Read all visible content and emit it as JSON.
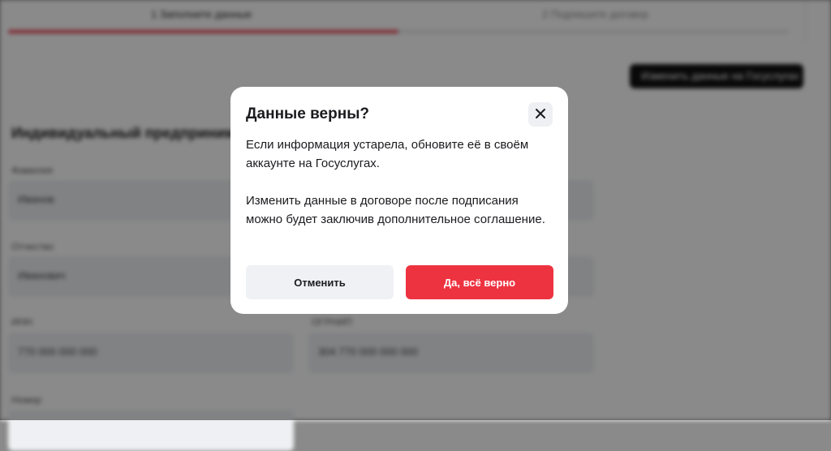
{
  "background": {
    "tabs": [
      {
        "label": "1  Заполните данные"
      },
      {
        "label": "2  Подпишите договор"
      }
    ],
    "progress_fraction": 0.5,
    "action_button": "Изменить данные на Госуслугах",
    "section_title": "Индивидуальный предприниматель",
    "fields": [
      {
        "label": "Фамилия",
        "value": "Иванов"
      },
      {
        "label": "Отчество",
        "value": "Иванович"
      },
      {
        "label": "ИНН",
        "value": "770 000 000 000"
      },
      {
        "label": "ОГРНИП",
        "value": "304 770 000 000 000"
      },
      {
        "label": "Номер",
        "value": ""
      }
    ]
  },
  "dialog": {
    "title": "Данные верны?",
    "paragraph1": "Если информация устарела, обновите её в своём аккаунте на Госуслугах.",
    "paragraph2": "Изменить данные в договоре после подписания можно будет заключив дополнительное соглашение.",
    "cancel_label": "Отменить",
    "confirm_label": "Да, всё верно",
    "close_icon": "close-icon"
  },
  "colors": {
    "accent": "#ee3340",
    "progress": "#e8364a",
    "secondary_button": "#f0f1f4",
    "overlay": "rgba(0,0,0,0.46)"
  }
}
